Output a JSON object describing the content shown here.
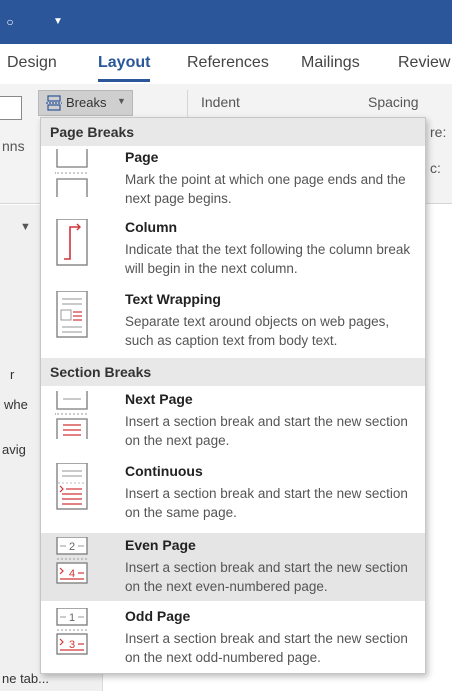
{
  "titlebar": {
    "circle_glyph": "○",
    "quick_access_glyph": "▼"
  },
  "tabs": [
    "Design",
    "Layout",
    "References",
    "Mailings",
    "Review"
  ],
  "ribbon": {
    "breaks_label": "Breaks",
    "indent_label": "Indent",
    "spacing_label": "Spacing",
    "partial_left": "nns",
    "partial_right_1": "re:",
    "partial_right_2": "c:"
  },
  "left_pane": {
    "partial_1": "r",
    "partial_2": "whe",
    "partial_3": "avig",
    "partial_4": "ne tab..."
  },
  "menu": {
    "sections": [
      {
        "header": "Page Breaks",
        "items": [
          {
            "title": "Page",
            "desc": "Mark the point at which one page ends and the next page begins.",
            "icon": "page-break-icon"
          },
          {
            "title": "Column",
            "desc": "Indicate that the text following the column break will begin in the next column.",
            "icon": "column-break-icon"
          },
          {
            "title": "Text Wrapping",
            "desc": "Separate text around objects on web pages, such as caption text from body text.",
            "icon": "text-wrapping-icon"
          }
        ]
      },
      {
        "header": "Section Breaks",
        "items": [
          {
            "title": "Next Page",
            "desc": "Insert a section break and start the new section on the next page.",
            "icon": "next-page-icon"
          },
          {
            "title": "Continuous",
            "desc": "Insert a section break and start the new section on the same page.",
            "icon": "continuous-icon"
          },
          {
            "title": "Even Page",
            "desc": "Insert a section break and start the new section on the next even-numbered page.",
            "icon": "even-page-icon"
          },
          {
            "title": "Odd Page",
            "desc": "Insert a section break and start the new section on the next odd-numbered page.",
            "icon": "odd-page-icon"
          }
        ]
      }
    ],
    "even_page_numbers": [
      "2",
      "4"
    ],
    "odd_page_numbers": [
      "1",
      "3"
    ]
  },
  "colors": {
    "accent": "#2b579a",
    "break_red": "#d13438",
    "icon_gray": "#7a7a7a"
  }
}
